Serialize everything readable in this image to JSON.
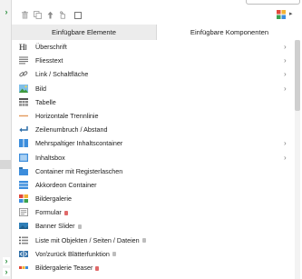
{
  "left_strip": {
    "expand_glyph": "›"
  },
  "toolbar": {
    "icons": [
      "trash-icon",
      "copy-icon",
      "arrow-up-icon",
      "link-icon",
      "checkbox-icon",
      "grid-icon",
      "more-icon"
    ],
    "more_glyph": "▸"
  },
  "tabs": [
    {
      "label": "Einfügbare Elemente",
      "active": true
    },
    {
      "label": "Einfügbare Komponenten",
      "active": false
    }
  ],
  "items": [
    {
      "label": "Überschrift",
      "icon": "heading-icon",
      "submenu": true,
      "lock": ""
    },
    {
      "label": "Fliesstext",
      "icon": "text-lines-icon",
      "submenu": true,
      "lock": ""
    },
    {
      "label": "Link / Schaltfläche",
      "icon": "link-icon",
      "submenu": true,
      "lock": ""
    },
    {
      "label": "Bild",
      "icon": "image-icon",
      "submenu": true,
      "lock": ""
    },
    {
      "label": "Tabelle",
      "icon": "table-icon",
      "submenu": false,
      "lock": ""
    },
    {
      "label": "Horizontale Trennlinie",
      "icon": "horizontal-rule-icon",
      "submenu": false,
      "lock": ""
    },
    {
      "label": "Zeilenumbruch / Abstand",
      "icon": "line-break-icon",
      "submenu": false,
      "lock": ""
    },
    {
      "label": "Mehrspaltiger Inhaltscontainer",
      "icon": "columns-icon",
      "submenu": true,
      "lock": ""
    },
    {
      "label": "Inhaltsbox",
      "icon": "content-box-icon",
      "submenu": true,
      "lock": ""
    },
    {
      "label": "Container mit Registerlaschen",
      "icon": "tabs-container-icon",
      "submenu": false,
      "lock": ""
    },
    {
      "label": "Akkordeon Container",
      "icon": "accordion-icon",
      "submenu": false,
      "lock": ""
    },
    {
      "label": "Bildergalerie",
      "icon": "gallery-icon",
      "submenu": false,
      "lock": ""
    },
    {
      "label": "Formular",
      "icon": "form-icon",
      "submenu": false,
      "lock": "red"
    },
    {
      "label": "Banner Slider",
      "icon": "banner-slider-icon",
      "submenu": false,
      "lock": "grey"
    },
    {
      "label": "Liste mit Objekten / Seiten / Dateien",
      "icon": "object-list-icon",
      "submenu": false,
      "lock": "grey"
    },
    {
      "label": "Vor/zurück Blätterfunktion",
      "icon": "prev-next-icon",
      "submenu": false,
      "lock": "grey"
    },
    {
      "label": "Bildergalerie Teaser",
      "icon": "gallery-teaser-icon",
      "submenu": false,
      "lock": "red"
    }
  ],
  "colors": {
    "accent_green": "#2a8f3e",
    "icon_blue": "#3c8ddc",
    "lock_red": "#e06a6a"
  }
}
